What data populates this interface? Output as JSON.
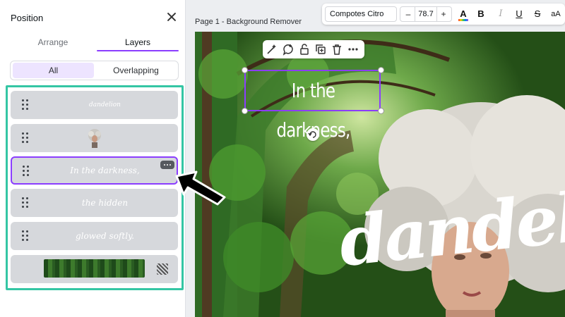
{
  "panel": {
    "title": "Position",
    "tabs": {
      "arrange": "Arrange",
      "layers": "Layers",
      "active": "Layers"
    },
    "filters": {
      "all": "All",
      "overlapping": "Overlapping",
      "active": "All"
    },
    "layers": [
      {
        "kind": "text",
        "label": "dandelion"
      },
      {
        "kind": "image",
        "icon": "person-thumbnail-icon"
      },
      {
        "kind": "text",
        "label": "In the darkness,",
        "selected": true
      },
      {
        "kind": "text",
        "label": "the hidden"
      },
      {
        "kind": "text",
        "label": "glowed softly."
      },
      {
        "kind": "background",
        "icon": "forest-thumbnail"
      }
    ]
  },
  "toolbar": {
    "font": "Compotes Citro",
    "minus": "–",
    "size": "78.7",
    "plus": "+",
    "color_glyph": "A",
    "bold": "B",
    "italic": "I",
    "underline": "U",
    "strike": "S",
    "case": "aA"
  },
  "canvas": {
    "page_label": "Page 1 - Background Remover",
    "selected_text": "In the darkness,",
    "big_word": "dandeli",
    "ctx_icons": [
      "magic-write-icon",
      "comment-icon",
      "lock-icon",
      "duplicate-icon",
      "trash-icon",
      "more-icon"
    ]
  },
  "colors": {
    "accent": "#8b3dff",
    "highlight": "#34c6a4",
    "layer_bg": "#d6d8dc"
  }
}
